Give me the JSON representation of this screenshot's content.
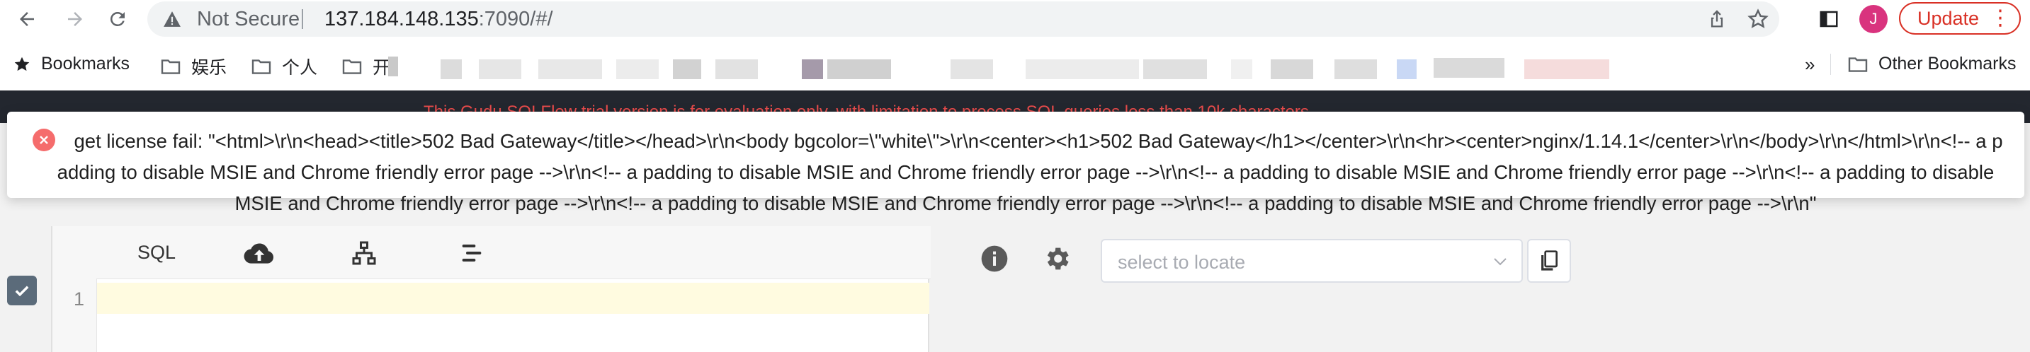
{
  "browser": {
    "security_label": "Not Secure",
    "url_host": "137.184.148.135",
    "url_rest": ":7090/#/",
    "avatar_letter": "J",
    "update_label": "Update",
    "update_menu": "⋮"
  },
  "bookmarks": {
    "bookmarks_label": "Bookmarks",
    "folders": [
      "娱乐",
      "个人",
      "开"
    ],
    "overflow": "»",
    "other_label": "Other Bookmarks"
  },
  "app": {
    "trial_notice": "This Gudu SQLFlow trial version is for evaluation only, with limitation to process SQL queries less than 10k characters.",
    "editor": {
      "tab_sql": "SQL",
      "line_number": "1"
    },
    "locate": {
      "placeholder": "select to locate"
    }
  },
  "toast": {
    "message": "get license fail: \"<html>\\r\\n<head><title>502 Bad Gateway</title></head>\\r\\n<body bgcolor=\\\"white\\\">\\r\\n<center><h1>502 Bad Gateway</h1></center>\\r\\n<hr><center>nginx/1.14.1</center>\\r\\n</body>\\r\\n</html>\\r\\n<!-- a padding to disable MSIE and Chrome friendly error page -->\\r\\n<!-- a padding to disable MSIE and Chrome friendly error page -->\\r\\n<!-- a padding to disable MSIE and Chrome friendly error page -->\\r\\n<!-- a padding to disable MSIE and Chrome friendly error page -->\\r\\n<!-- a padding to disable MSIE and Chrome friendly error page -->\\r\\n<!-- a padding to disable MSIE and Chrome friendly error page -->\\r\\n\""
  },
  "colors": {
    "error": "#f56c6c",
    "update": "#d93025",
    "trial_text": "#e84b4b",
    "dark_header": "#23272f"
  }
}
